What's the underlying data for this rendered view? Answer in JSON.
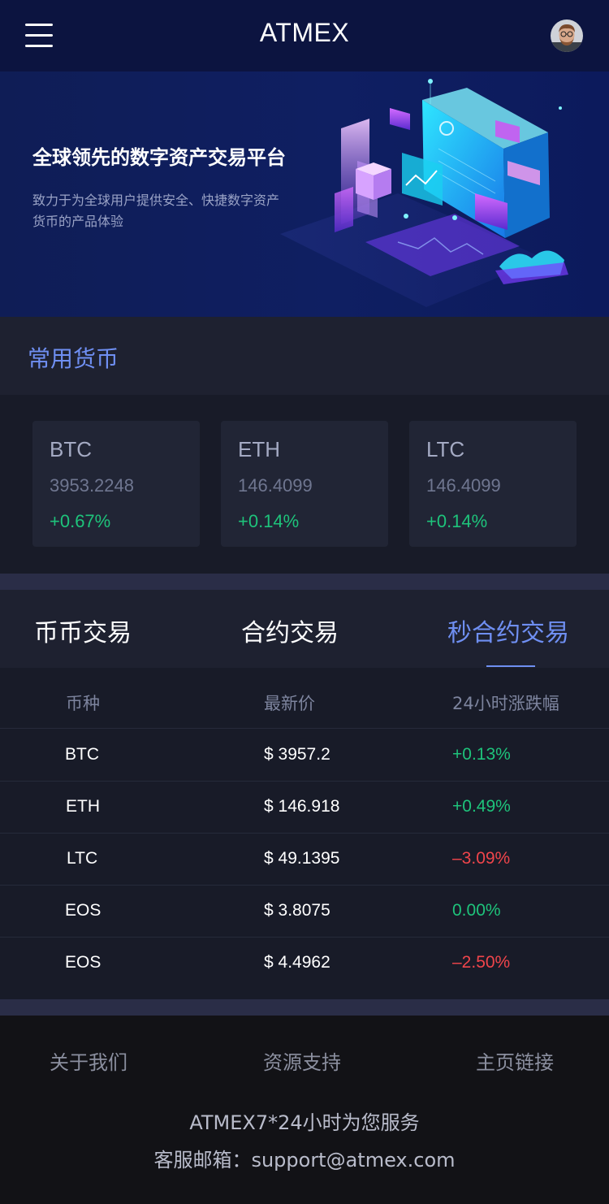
{
  "header": {
    "app_title": "ATMEX"
  },
  "banner": {
    "title": "全球领先的数字资产交易平台",
    "subtitle": "致力于为全球用户提供安全、快捷数字资产货币的产品体验"
  },
  "section": {
    "title": "常用货币"
  },
  "cards": [
    {
      "symbol": "BTC",
      "price": "3953.2248",
      "change": "+0.67%"
    },
    {
      "symbol": "ETH",
      "price": "146.4099",
      "change": "+0.14%"
    },
    {
      "symbol": "LTC",
      "price": "146.4099",
      "change": "+0.14%"
    }
  ],
  "tabs": [
    {
      "label": "币币交易",
      "active": false
    },
    {
      "label": "合约交易",
      "active": false
    },
    {
      "label": "秒合约交易",
      "active": true
    }
  ],
  "table": {
    "headers": [
      "币种",
      "最新价",
      "24小时涨跌幅"
    ],
    "rows": [
      {
        "coin": "BTC",
        "price": "$ 3957.2",
        "change": "+0.13%",
        "trend": "up"
      },
      {
        "coin": "ETH",
        "price": "$ 146.918",
        "change": "+0.49%",
        "trend": "up"
      },
      {
        "coin": "LTC",
        "price": "$ 49.1395",
        "change": "–3.09%",
        "trend": "down"
      },
      {
        "coin": "EOS",
        "price": "$ 3.8075",
        "change": "0.00%",
        "trend": "up"
      },
      {
        "coin": "EOS",
        "price": "$ 4.4962",
        "change": "–2.50%",
        "trend": "down"
      }
    ]
  },
  "footer": {
    "links": [
      "关于我们",
      "资源支持",
      "主页链接"
    ],
    "service_text": "ATMEX7*24小时为您服务",
    "email_text": "客服邮箱：support@atmex.com"
  },
  "colors": {
    "accent": "#6f8ff2",
    "up": "#1ec37b",
    "down": "#f0454b",
    "header_bg": "#0c1440"
  },
  "icons": {
    "menu": "hamburger-menu-icon",
    "avatar": "user-avatar"
  }
}
